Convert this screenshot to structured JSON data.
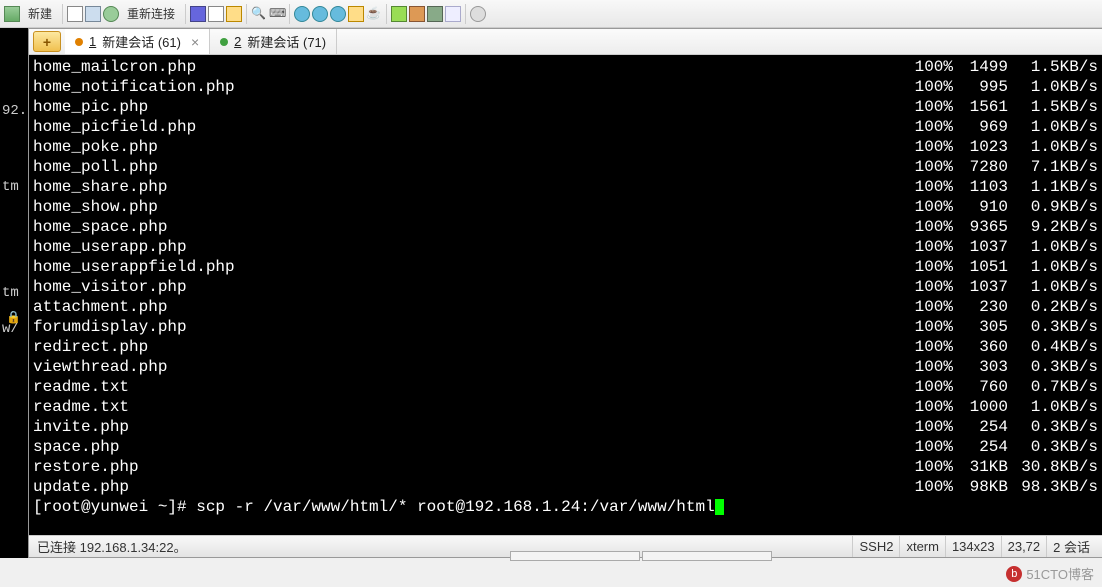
{
  "toolbar": {
    "new_label": "新建",
    "reconnect_label": "重新连接"
  },
  "tabs": {
    "active": {
      "index": "1",
      "label": "新建会话 (61)"
    },
    "second": {
      "index": "2",
      "label": "新建会话 (71)"
    }
  },
  "left": {
    "addr": "92.",
    "tag1": "tm",
    "tag2": "tm",
    "tag3": "w/"
  },
  "terminal": {
    "rows": [
      {
        "name": "home_mailcron.php",
        "pct": "100%",
        "size": "1499",
        "speed": "1.5KB/s"
      },
      {
        "name": "home_notification.php",
        "pct": "100%",
        "size": "995",
        "speed": "1.0KB/s"
      },
      {
        "name": "home_pic.php",
        "pct": "100%",
        "size": "1561",
        "speed": "1.5KB/s"
      },
      {
        "name": "home_picfield.php",
        "pct": "100%",
        "size": "969",
        "speed": "1.0KB/s"
      },
      {
        "name": "home_poke.php",
        "pct": "100%",
        "size": "1023",
        "speed": "1.0KB/s"
      },
      {
        "name": "home_poll.php",
        "pct": "100%",
        "size": "7280",
        "speed": "7.1KB/s"
      },
      {
        "name": "home_share.php",
        "pct": "100%",
        "size": "1103",
        "speed": "1.1KB/s"
      },
      {
        "name": "home_show.php",
        "pct": "100%",
        "size": "910",
        "speed": "0.9KB/s"
      },
      {
        "name": "home_space.php",
        "pct": "100%",
        "size": "9365",
        "speed": "9.2KB/s"
      },
      {
        "name": "home_userapp.php",
        "pct": "100%",
        "size": "1037",
        "speed": "1.0KB/s"
      },
      {
        "name": "home_userappfield.php",
        "pct": "100%",
        "size": "1051",
        "speed": "1.0KB/s"
      },
      {
        "name": "home_visitor.php",
        "pct": "100%",
        "size": "1037",
        "speed": "1.0KB/s"
      },
      {
        "name": "attachment.php",
        "pct": "100%",
        "size": "230",
        "speed": "0.2KB/s"
      },
      {
        "name": "forumdisplay.php",
        "pct": "100%",
        "size": "305",
        "speed": "0.3KB/s"
      },
      {
        "name": "redirect.php",
        "pct": "100%",
        "size": "360",
        "speed": "0.4KB/s"
      },
      {
        "name": "viewthread.php",
        "pct": "100%",
        "size": "303",
        "speed": "0.3KB/s"
      },
      {
        "name": "readme.txt",
        "pct": "100%",
        "size": "760",
        "speed": "0.7KB/s"
      },
      {
        "name": "readme.txt",
        "pct": "100%",
        "size": "1000",
        "speed": "1.0KB/s"
      },
      {
        "name": "invite.php",
        "pct": "100%",
        "size": "254",
        "speed": "0.3KB/s"
      },
      {
        "name": "space.php",
        "pct": "100%",
        "size": "254",
        "speed": "0.3KB/s"
      },
      {
        "name": "restore.php",
        "pct": "100%",
        "size": "31KB",
        "speed": "30.8KB/s"
      },
      {
        "name": "update.php",
        "pct": "100%",
        "size": "98KB",
        "speed": "98.3KB/s"
      }
    ],
    "prompt": "[root@yunwei ~]# scp -r /var/www/html/* root@192.168.1.24:/var/www/html"
  },
  "status": {
    "connected": "已连接 192.168.1.34:22。",
    "proto": "SSH2",
    "term": "xterm",
    "size": "134x23",
    "cursor": "23,72",
    "sessions": "2 会话"
  },
  "watermark": "51CTO博客"
}
